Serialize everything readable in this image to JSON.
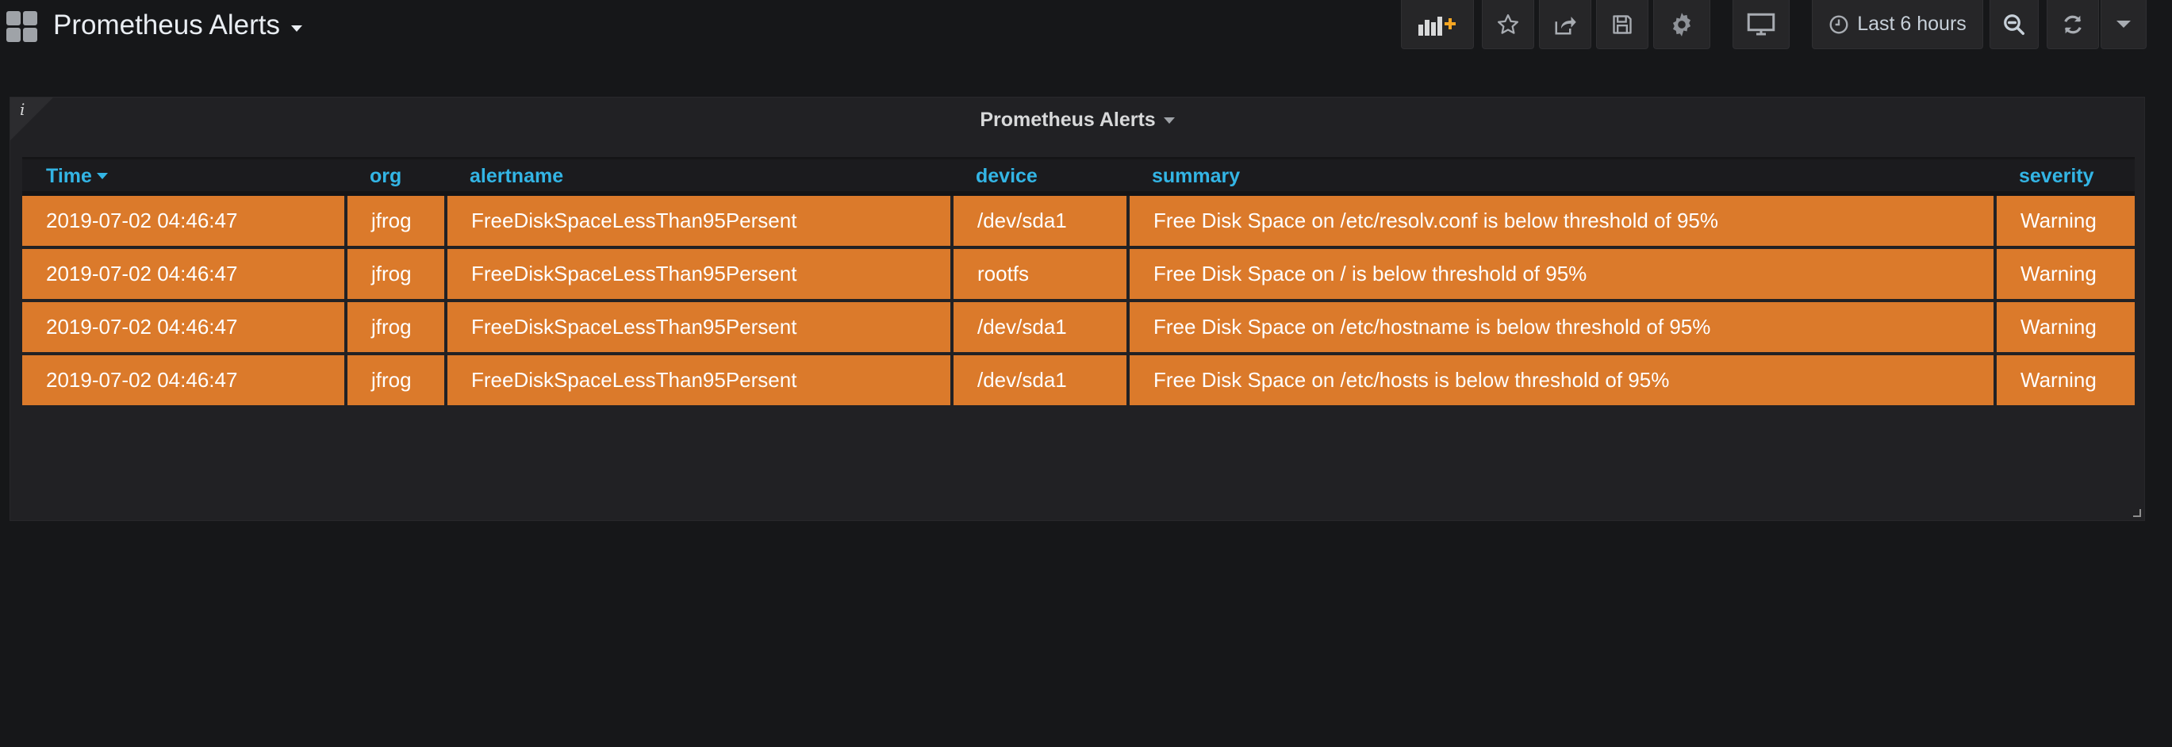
{
  "dashboard": {
    "title": "Prometheus Alerts"
  },
  "toolbar": {
    "add_panel_icon": "bar-chart-plus-icon",
    "star_icon": "star-icon",
    "share_icon": "share-icon",
    "save_icon": "save-icon",
    "settings_icon": "gear-icon",
    "tv_icon": "monitor-icon",
    "time_range_label": "Last 6 hours",
    "zoom_icon": "zoom-out-icon",
    "refresh_icon": "refresh-icon",
    "refresh_menu_icon": "chevron-down-icon"
  },
  "panel": {
    "info_icon": "i",
    "title": "Prometheus Alerts",
    "columns": {
      "time": "Time",
      "org": "org",
      "alertname": "alertname",
      "device": "device",
      "summary": "summary",
      "severity": "severity"
    },
    "rows": [
      {
        "time": "2019-07-02 04:46:47",
        "org": "jfrog",
        "alertname": "FreeDiskSpaceLessThan95Persent",
        "device": "/dev/sda1",
        "summary": "Free Disk Space on /etc/resolv.conf is below threshold of 95%",
        "severity": "Warning"
      },
      {
        "time": "2019-07-02 04:46:47",
        "org": "jfrog",
        "alertname": "FreeDiskSpaceLessThan95Persent",
        "device": "rootfs",
        "summary": "Free Disk Space on / is below threshold of 95%",
        "severity": "Warning"
      },
      {
        "time": "2019-07-02 04:46:47",
        "org": "jfrog",
        "alertname": "FreeDiskSpaceLessThan95Persent",
        "device": "/dev/sda1",
        "summary": "Free Disk Space on /etc/hostname is below threshold of 95%",
        "severity": "Warning"
      },
      {
        "time": "2019-07-02 04:46:47",
        "org": "jfrog",
        "alertname": "FreeDiskSpaceLessThan95Persent",
        "device": "/dev/sda1",
        "summary": "Free Disk Space on /etc/hosts is below threshold of 95%",
        "severity": "Warning"
      }
    ],
    "row_color": "#db7a2b",
    "header_color": "#33b5e5"
  }
}
